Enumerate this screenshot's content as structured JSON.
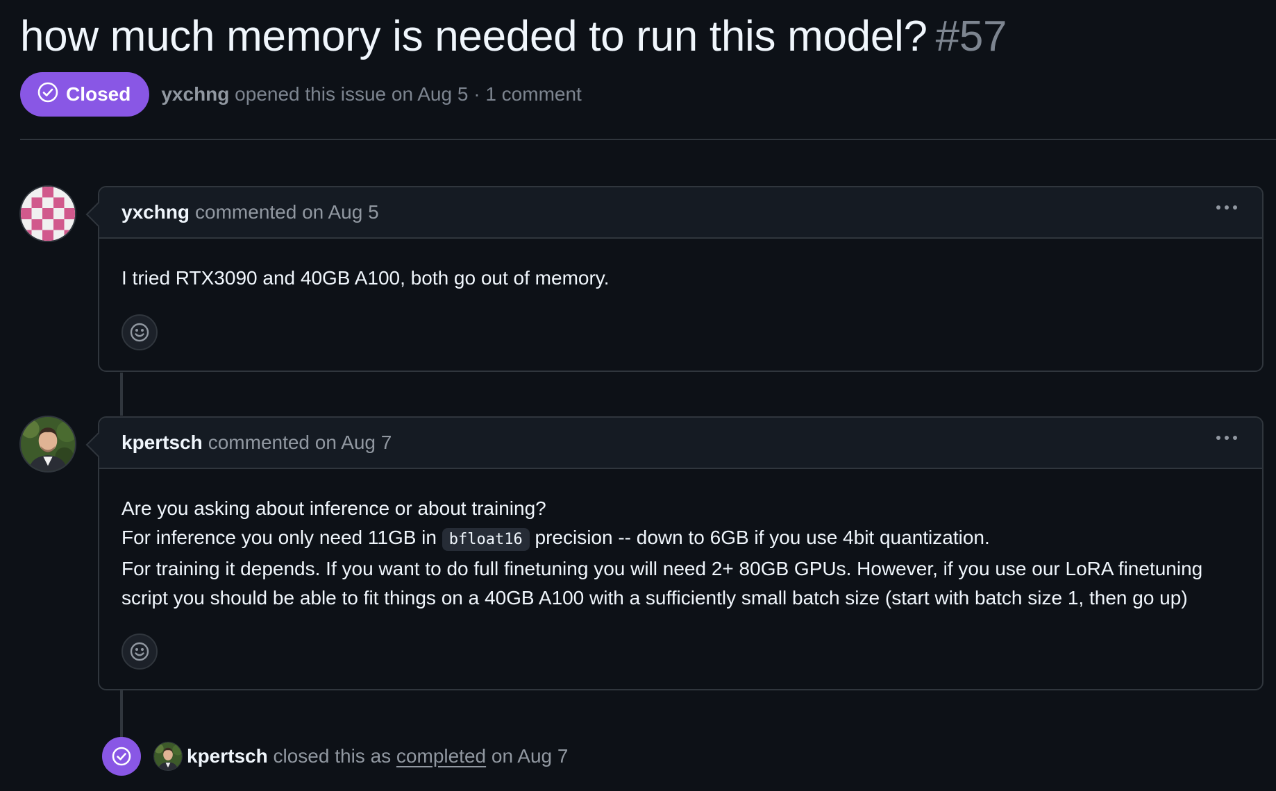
{
  "issue": {
    "title": "how much memory is needed to run this model?",
    "number": "#57",
    "state_label": "Closed",
    "state_color": "#8957e5",
    "opened_by": "yxchng",
    "opened_text": "opened this issue on Aug 5 · 1 comment"
  },
  "comments": [
    {
      "author": "yxchng",
      "action": "commented on Aug 5",
      "avatar": "identicon-pink",
      "lines": [
        "I tried RTX3090 and 40GB A100, both go out of memory."
      ]
    },
    {
      "author": "kpertsch",
      "action": "commented on Aug 7",
      "avatar": "photo-avatar",
      "line1": "Are you asking about inference or about training?",
      "line2_before": "For inference you only need 11GB in",
      "line2_code": "bfloat16",
      "line2_after": "precision -- down to 6GB if you use 4bit quantization.",
      "line3": "For training it depends. If you want to do full finetuning you will need 2+ 80GB GPUs. However, if you use our LoRA finetuning script you should be able to fit things on a 40GB A100 with a sufficiently small batch size (start with batch size 1, then go up)"
    }
  ],
  "event": {
    "author": "kpertsch",
    "before_link": "closed this as",
    "link": "completed",
    "after_link": "on Aug 7",
    "icon": "check-circle-icon"
  },
  "colors": {
    "background": "#0d1117",
    "border": "#30363d",
    "muted": "#9198a1",
    "accent_purple": "#8957e5"
  }
}
